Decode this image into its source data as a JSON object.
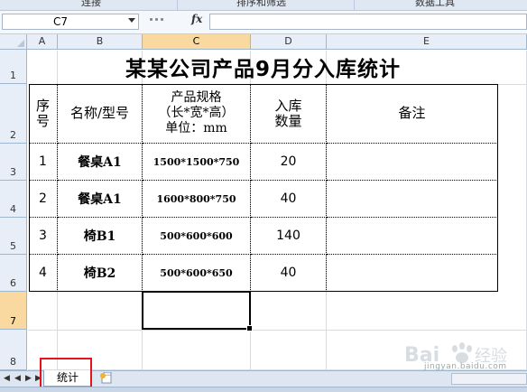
{
  "ribbon": {
    "groups": [
      "连接",
      "排序和筛选",
      "数据工具"
    ]
  },
  "formula_bar": {
    "name_box": "C7",
    "fx_label": "fx",
    "formula": ""
  },
  "columns": [
    "A",
    "B",
    "C",
    "D",
    "E"
  ],
  "selected_column": "C",
  "rows": [
    "1",
    "2",
    "3",
    "4",
    "5",
    "6",
    "7",
    "8"
  ],
  "selected_row": "7",
  "sheet": {
    "title": "某某公司产品9月分入库统计",
    "header": {
      "seq_l1": "序",
      "seq_l2": "号",
      "name": "名称/型号",
      "spec_l1": "产品规格",
      "spec_l2": "（长*宽*高）",
      "spec_l3": "单位：mm",
      "qty_l1": "入库",
      "qty_l2": "数量",
      "note": "备注"
    },
    "records": [
      {
        "seq": "1",
        "name": "餐桌A1",
        "spec": "1500*1500*750",
        "qty": "20",
        "note": ""
      },
      {
        "seq": "2",
        "name": "餐桌A1",
        "spec": "1600*800*750",
        "qty": "40",
        "note": ""
      },
      {
        "seq": "3",
        "name": "椅B1",
        "spec": "500*600*600",
        "qty": "140",
        "note": ""
      },
      {
        "seq": "4",
        "name": "椅B2",
        "spec": "500*600*650",
        "qty": "40",
        "note": ""
      }
    ]
  },
  "tabs": {
    "active": "统计"
  },
  "watermark": {
    "text": "Baidu 经验",
    "sub": "jingyan.baidu.com"
  }
}
